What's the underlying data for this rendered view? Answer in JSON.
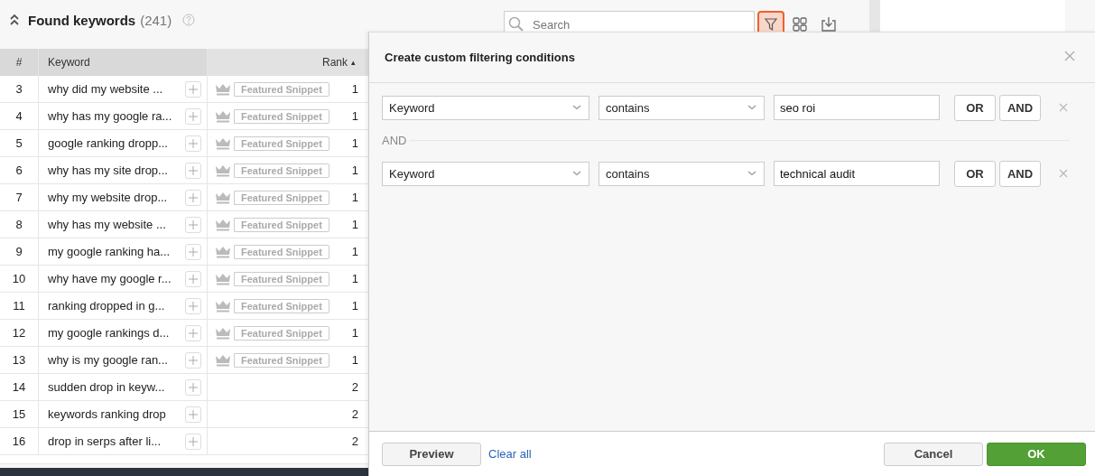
{
  "header": {
    "title": "Found keywords",
    "count": "(241)"
  },
  "toolbar": {
    "search_placeholder": "Search",
    "filter_active": true
  },
  "table": {
    "columns": [
      {
        "label": "#"
      },
      {
        "label": "Keyword"
      },
      {
        "label": "Rank",
        "sort_mark": "▴"
      }
    ],
    "rows": [
      {
        "num": "3",
        "keyword": "why did my website ...",
        "snippet": "Featured Snippet",
        "rank": "1"
      },
      {
        "num": "4",
        "keyword": "why has my google ra...",
        "snippet": "Featured Snippet",
        "rank": "1"
      },
      {
        "num": "5",
        "keyword": "google ranking dropp...",
        "snippet": "Featured Snippet",
        "rank": "1"
      },
      {
        "num": "6",
        "keyword": "why has my site drop...",
        "snippet": "Featured Snippet",
        "rank": "1"
      },
      {
        "num": "7",
        "keyword": "why my website drop...",
        "snippet": "Featured Snippet",
        "rank": "1"
      },
      {
        "num": "8",
        "keyword": "why has my website ...",
        "snippet": "Featured Snippet",
        "rank": "1"
      },
      {
        "num": "9",
        "keyword": "my google ranking ha...",
        "snippet": "Featured Snippet",
        "rank": "1"
      },
      {
        "num": "10",
        "keyword": "why have my google r...",
        "snippet": "Featured Snippet",
        "rank": "1"
      },
      {
        "num": "11",
        "keyword": "ranking dropped in g...",
        "snippet": "Featured Snippet",
        "rank": "1"
      },
      {
        "num": "12",
        "keyword": "my google rankings d...",
        "snippet": "Featured Snippet",
        "rank": "1"
      },
      {
        "num": "13",
        "keyword": "why is my google ran...",
        "snippet": "Featured Snippet",
        "rank": "1"
      },
      {
        "num": "14",
        "keyword": "sudden drop in keyw...",
        "rank": "2"
      },
      {
        "num": "15",
        "keyword": "keywords ranking drop",
        "rank": "2"
      },
      {
        "num": "16",
        "keyword": "drop in serps after li...",
        "rank": "2"
      }
    ]
  },
  "dialog": {
    "title": "Create custom filtering conditions",
    "conditions": [
      {
        "field": "Keyword",
        "operator": "contains",
        "value": "seo roi",
        "buttons": [
          "OR",
          "AND"
        ]
      },
      {
        "joined_by": "AND",
        "field": "Keyword",
        "operator": "contains",
        "value": "technical audit",
        "buttons": [
          "OR",
          "AND"
        ]
      }
    ],
    "footer": {
      "preview": "Preview",
      "clear": "Clear all",
      "cancel": "Cancel",
      "ok": "OK"
    }
  }
}
